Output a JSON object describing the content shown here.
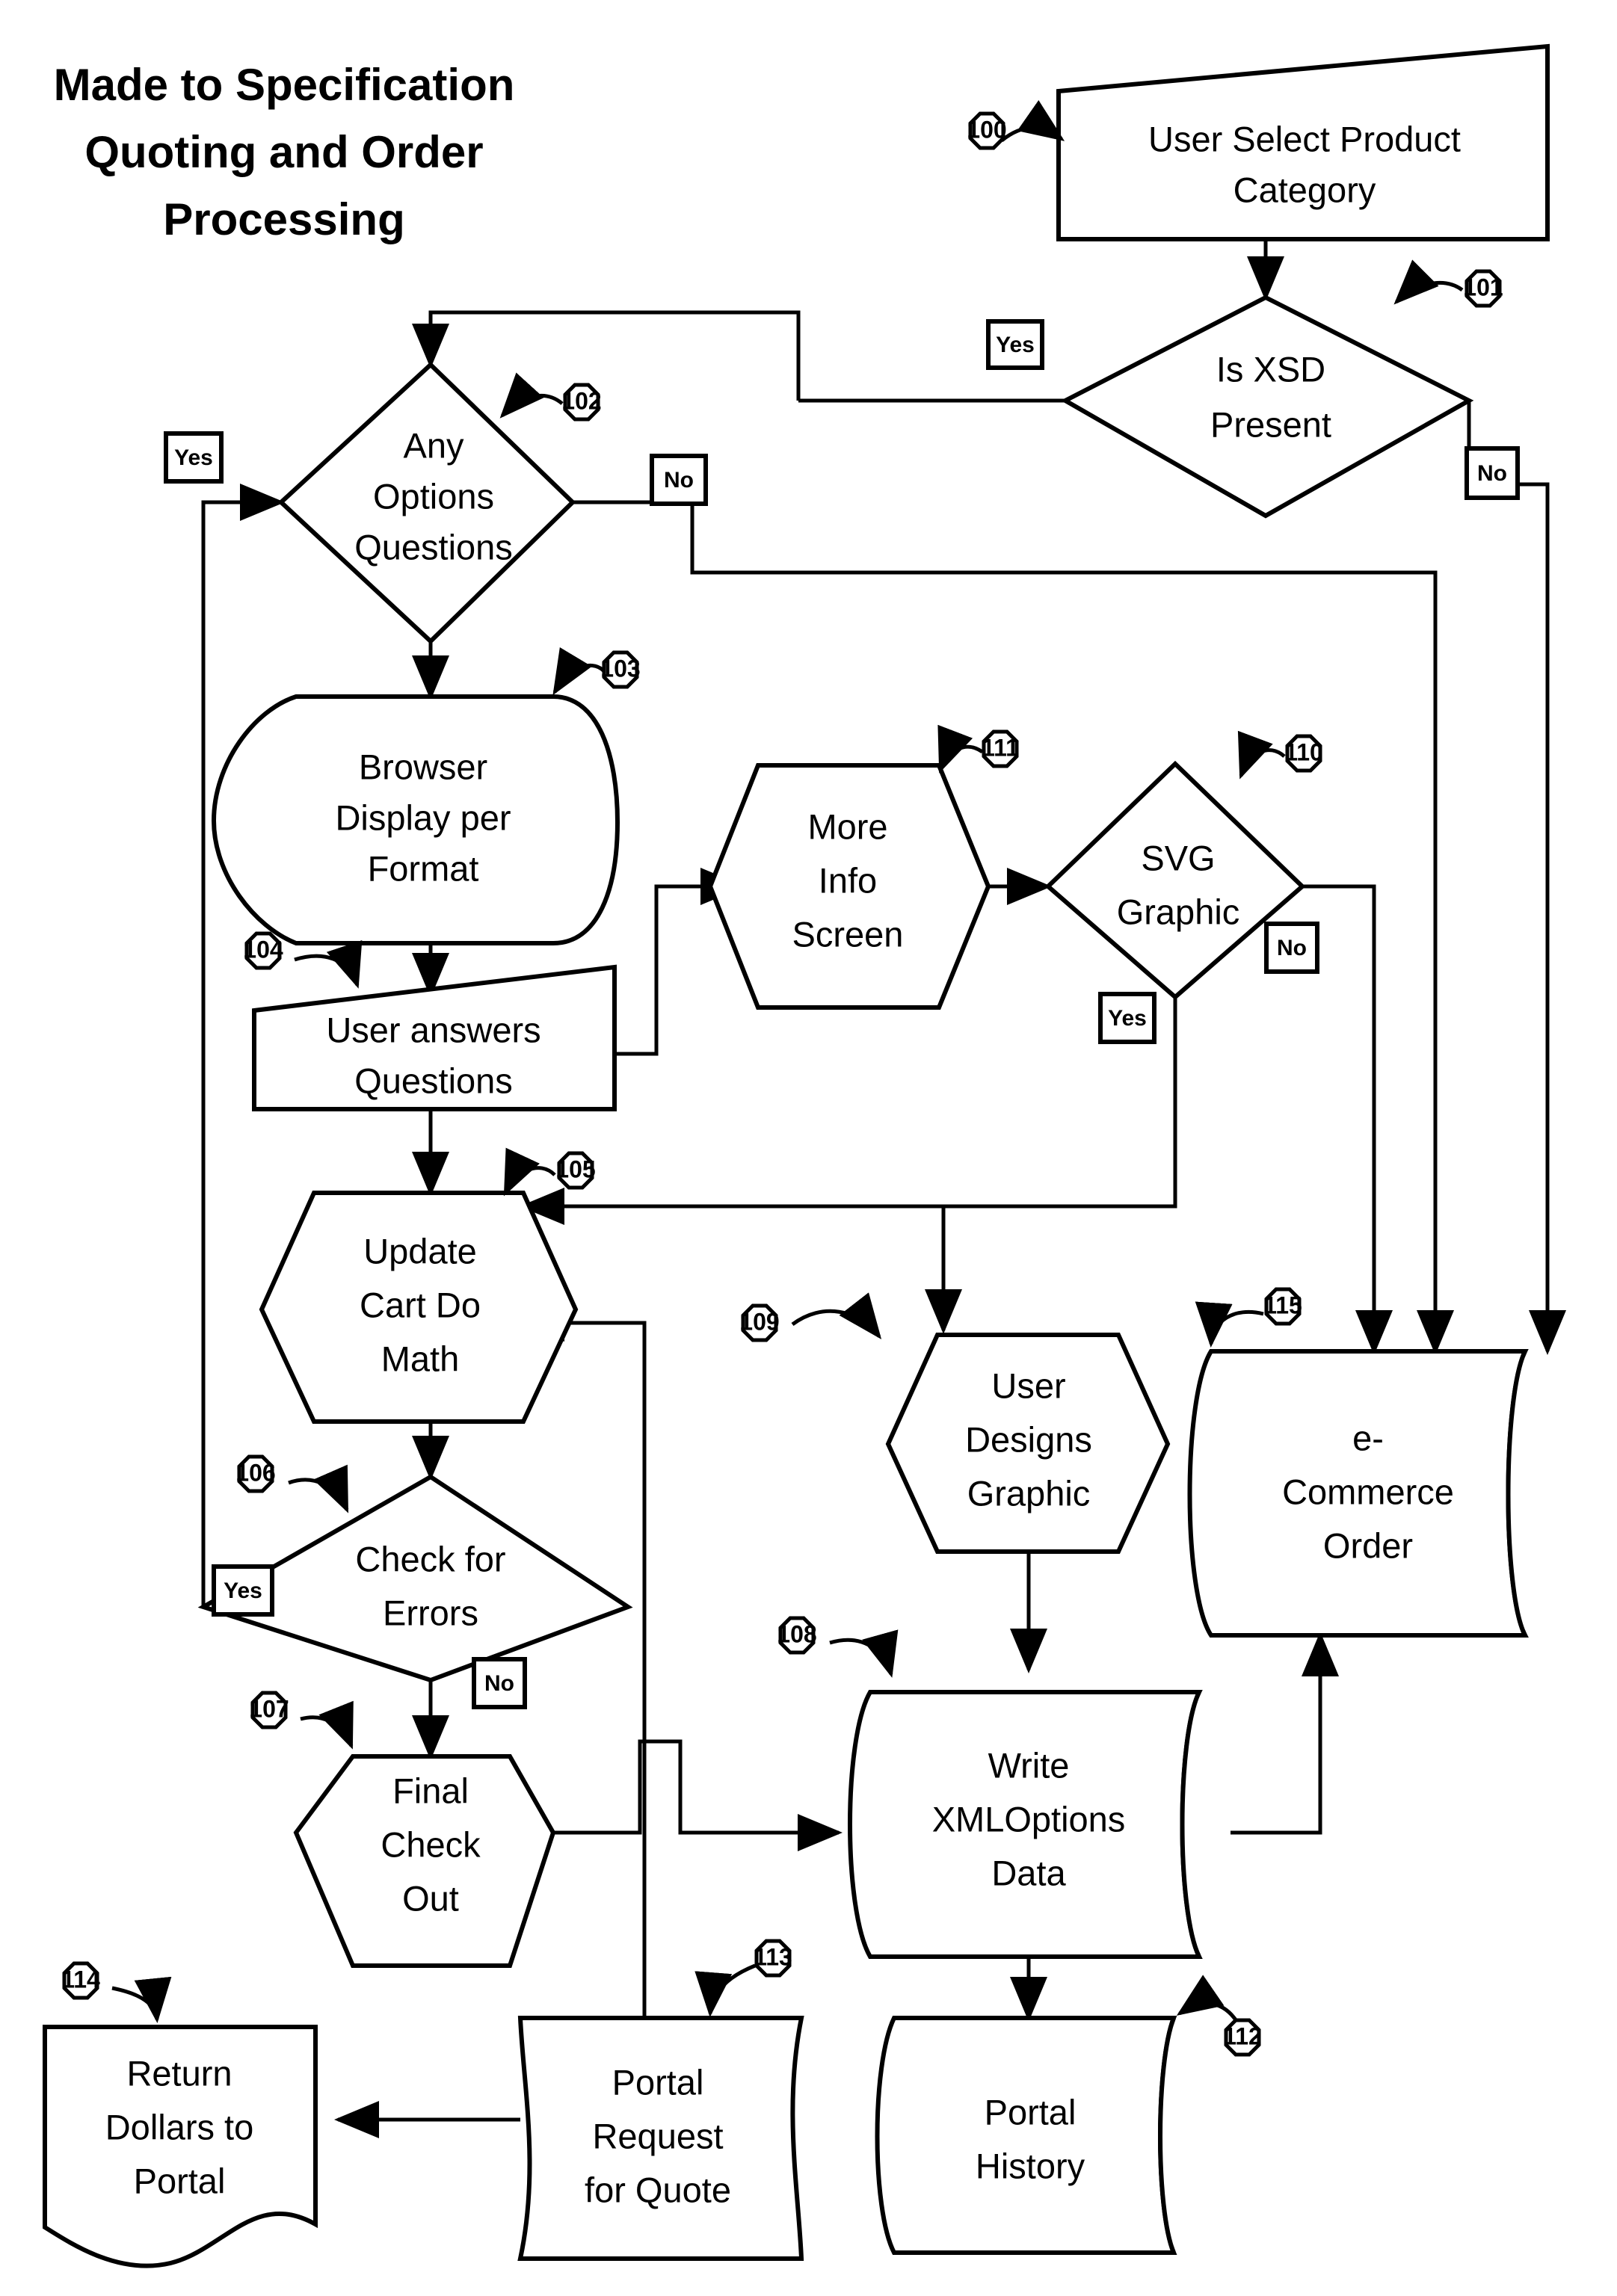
{
  "title": {
    "line1": "Made to Specification",
    "line2": "Quoting and Order",
    "line3": "Processing"
  },
  "nodes": {
    "n100": {
      "ref": "100",
      "line1": "User Select Product",
      "line2": "Category",
      "shape": "manual-input"
    },
    "n101": {
      "ref": "101",
      "line1": "Is XSD",
      "line2": "Present",
      "shape": "decision"
    },
    "n102": {
      "ref": "102",
      "line1": "Any",
      "line2": "Options",
      "line3": "Questions",
      "shape": "decision"
    },
    "n103": {
      "ref": "103",
      "line1": "Browser",
      "line2": "Display per",
      "line3": "Format",
      "shape": "display"
    },
    "n104": {
      "ref": "104",
      "line1": "User answers",
      "line2": "Questions",
      "shape": "manual-input"
    },
    "n105": {
      "ref": "105",
      "line1": "Update",
      "line2": "Cart Do",
      "line3": "Math",
      "shape": "preparation"
    },
    "n106": {
      "ref": "106",
      "line1": "Check for",
      "line2": "Errors",
      "shape": "decision"
    },
    "n107": {
      "ref": "107",
      "line1": "Final",
      "line2": "Check",
      "line3": "Out",
      "shape": "preparation"
    },
    "n108": {
      "ref": "108",
      "line1": "Write",
      "line2": "XMLOptions",
      "line3": "Data",
      "shape": "database"
    },
    "n109": {
      "ref": "109",
      "line1": "User",
      "line2": "Designs",
      "line3": "Graphic",
      "shape": "preparation"
    },
    "n110": {
      "ref": "110",
      "line1": "SVG",
      "line2": "Graphic",
      "shape": "decision"
    },
    "n111": {
      "ref": "111",
      "line1": "More",
      "line2": "Info",
      "line3": "Screen",
      "shape": "preparation"
    },
    "n112": {
      "ref": "112",
      "line1": "Portal",
      "line2": "History",
      "shape": "database"
    },
    "n113": {
      "ref": "113",
      "line1": "Portal",
      "line2": "Request",
      "line3": "for  Quote",
      "shape": "document"
    },
    "n114": {
      "ref": "114",
      "line1": "Return",
      "line2": "Dollars to",
      "line3": "Portal",
      "shape": "document"
    },
    "n115": {
      "ref": "115",
      "line1": "e-",
      "line2": "Commerce",
      "line3": "Order",
      "shape": "database"
    }
  },
  "branch_labels": {
    "xsd_yes": "Yes",
    "xsd_no": "No",
    "options_yes": "Yes",
    "options_no": "No",
    "svg_yes": "Yes",
    "svg_no": "No",
    "errors_yes": "Yes",
    "errors_no": "No"
  },
  "chart_data": {
    "type": "diagram",
    "diagram_kind": "flowchart",
    "title": "Made to Specification Quoting and Order Processing",
    "nodes": [
      {
        "id": "100",
        "label": "User Select Product Category",
        "shape": "manual-input"
      },
      {
        "id": "101",
        "label": "Is XSD Present",
        "shape": "decision"
      },
      {
        "id": "102",
        "label": "Any Options Questions",
        "shape": "decision"
      },
      {
        "id": "103",
        "label": "Browser Display per Format",
        "shape": "display"
      },
      {
        "id": "104",
        "label": "User answers Questions",
        "shape": "manual-input"
      },
      {
        "id": "105",
        "label": "Update Cart Do Math",
        "shape": "preparation"
      },
      {
        "id": "106",
        "label": "Check for Errors",
        "shape": "decision"
      },
      {
        "id": "107",
        "label": "Final Check Out",
        "shape": "preparation"
      },
      {
        "id": "108",
        "label": "Write XMLOptions Data",
        "shape": "database"
      },
      {
        "id": "109",
        "label": "User Designs Graphic",
        "shape": "preparation"
      },
      {
        "id": "110",
        "label": "SVG Graphic",
        "shape": "decision"
      },
      {
        "id": "111",
        "label": "More Info Screen",
        "shape": "preparation"
      },
      {
        "id": "112",
        "label": "Portal History",
        "shape": "database"
      },
      {
        "id": "113",
        "label": "Portal Request for Quote",
        "shape": "document"
      },
      {
        "id": "114",
        "label": "Return Dollars to Portal",
        "shape": "document"
      },
      {
        "id": "115",
        "label": "e-Commerce Order",
        "shape": "database"
      }
    ],
    "edges": [
      {
        "from": "100",
        "to": "101",
        "label": ""
      },
      {
        "from": "101",
        "to": "102",
        "label": "Yes"
      },
      {
        "from": "101",
        "to": "115",
        "label": "No"
      },
      {
        "from": "102",
        "to": "103",
        "label": "Yes"
      },
      {
        "from": "102",
        "to": "115",
        "label": "No"
      },
      {
        "from": "103",
        "to": "104",
        "label": ""
      },
      {
        "from": "104",
        "to": "105",
        "label": ""
      },
      {
        "from": "104",
        "to": "111",
        "label": ""
      },
      {
        "from": "111",
        "to": "110",
        "label": ""
      },
      {
        "from": "110",
        "to": "109",
        "label": "Yes"
      },
      {
        "from": "110",
        "to": "115",
        "label": "No"
      },
      {
        "from": "109",
        "to": "108",
        "label": ""
      },
      {
        "from": "109",
        "to": "105",
        "label": ""
      },
      {
        "from": "105",
        "to": "106",
        "label": ""
      },
      {
        "from": "106",
        "to": "102",
        "label": "Yes"
      },
      {
        "from": "106",
        "to": "107",
        "label": "No"
      },
      {
        "from": "107",
        "to": "108",
        "label": ""
      },
      {
        "from": "108",
        "to": "112",
        "label": ""
      },
      {
        "from": "108",
        "to": "115",
        "label": ""
      },
      {
        "from": "113",
        "to": "114",
        "label": ""
      },
      {
        "from": "113",
        "to": "105",
        "label": ""
      }
    ]
  }
}
